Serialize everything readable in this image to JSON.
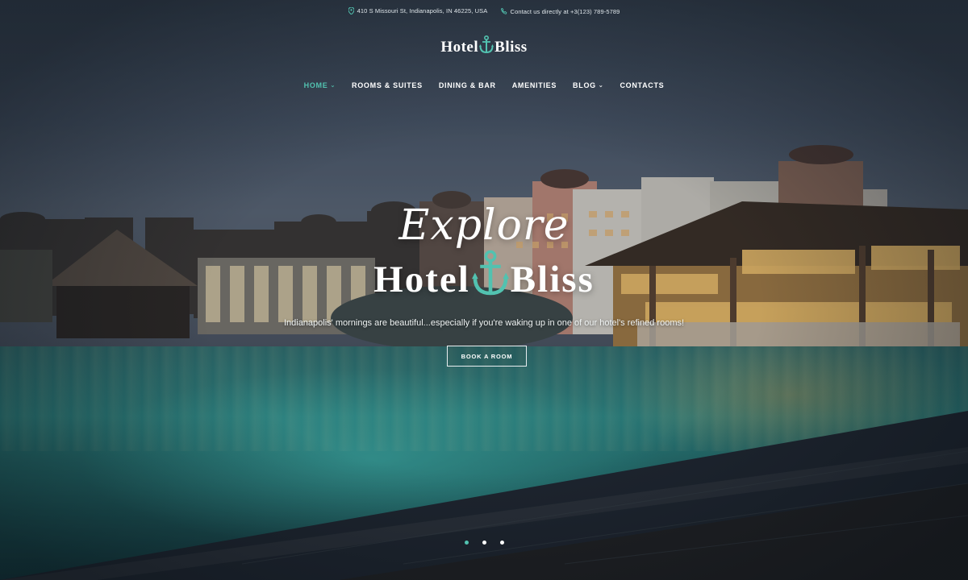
{
  "topbar": {
    "address": "410 S Missouri St, Indianapolis, IN 46225, USA",
    "contact": "Contact us directly at +3(123) 789-5789",
    "address_icon": "map-pin-icon",
    "contact_icon": "phone-icon"
  },
  "logo": {
    "word1": "Hotel",
    "word2": "Bliss",
    "icon": "anchor-icon"
  },
  "nav": {
    "items": [
      {
        "label": "HOME",
        "active": true,
        "dropdown": true
      },
      {
        "label": "ROOMS & SUITES",
        "active": false,
        "dropdown": false
      },
      {
        "label": "DINING & BAR",
        "active": false,
        "dropdown": false
      },
      {
        "label": "AMENITIES",
        "active": false,
        "dropdown": false
      },
      {
        "label": "BLOG",
        "active": false,
        "dropdown": true
      },
      {
        "label": "CONTACTS",
        "active": false,
        "dropdown": false
      }
    ],
    "chevron": "⌄"
  },
  "hero": {
    "script_line": "Explore",
    "title_word1": "Hotel",
    "title_word2": "Bliss",
    "subtitle": "Indianapolis' mornings are beautiful...especially if you're waking up in one of our hotel's refined rooms!",
    "button_label": "BOOK A ROOM"
  },
  "slider": {
    "count": 3,
    "active_index": 0
  },
  "colors": {
    "accent": "#52c2b0",
    "text": "#ffffff"
  }
}
